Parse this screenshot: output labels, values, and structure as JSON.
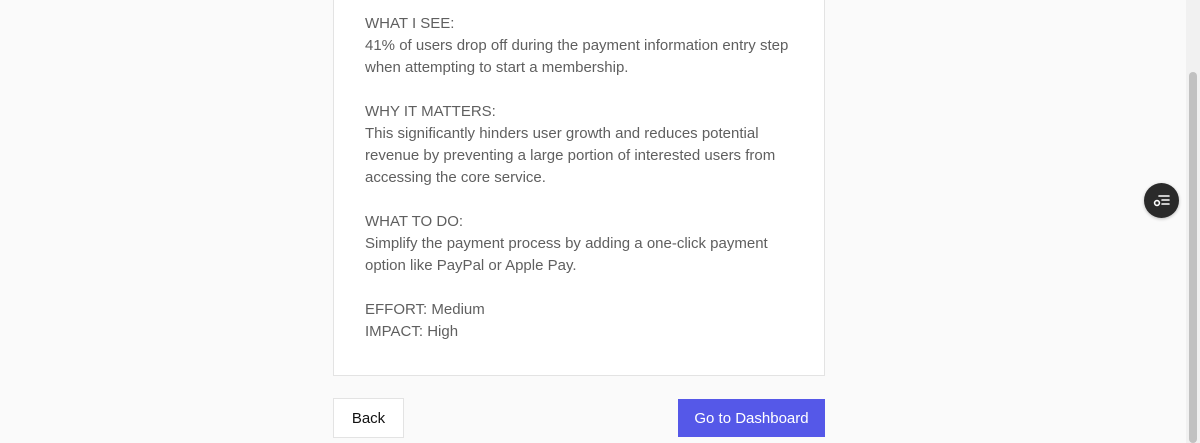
{
  "report": {
    "what_i_see_heading": "WHAT I SEE:",
    "what_i_see_line1": "41% of users drop off during the payment information entry step",
    "what_i_see_line2": "when attempting to start a membership.",
    "why_heading": "WHY IT MATTERS:",
    "why_line1": "This significantly hinders user growth and reduces potential",
    "why_line2": "revenue by preventing a large portion of interested users from",
    "why_line3": "accessing the core service.",
    "todo_heading": "WHAT TO DO:",
    "todo_line1": "Simplify the payment process by adding a one-click payment",
    "todo_line2": "option like PayPal or Apple Pay.",
    "effort": "EFFORT: Medium",
    "impact": "IMPACT: High"
  },
  "actions": {
    "back_label": "Back",
    "dashboard_label": "Go to Dashboard"
  },
  "floating_button": {
    "icon": "list-settings-icon"
  },
  "colors": {
    "primary": "#5558e8",
    "text": "#5f5f5f",
    "fab": "#2a2a2a"
  }
}
